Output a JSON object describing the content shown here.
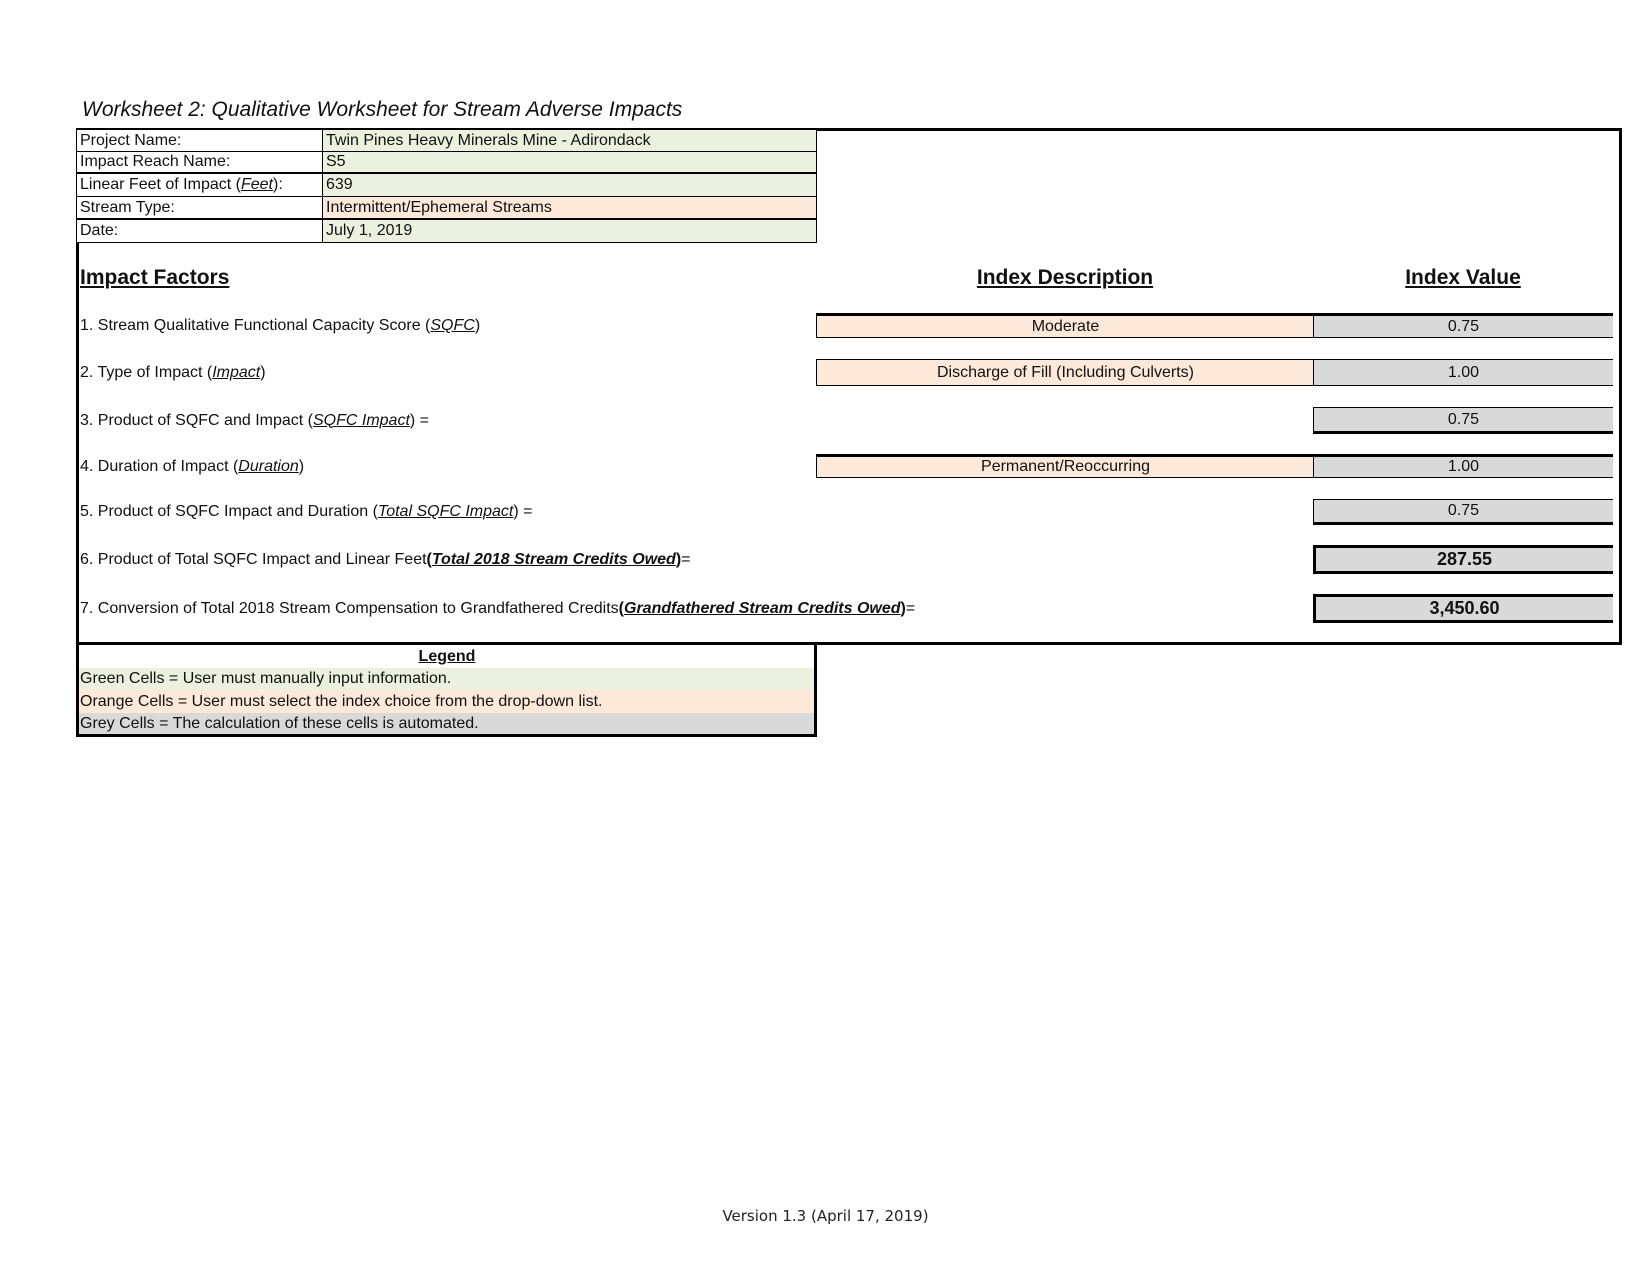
{
  "title": "Worksheet 2:  Qualitative Worksheet for Stream Adverse Impacts",
  "info": {
    "project_name": {
      "label": "Project Name:",
      "value": "Twin Pines Heavy Minerals Mine - Adirondack"
    },
    "impact_reach_name": {
      "label": "Impact Reach Name:",
      "value": "S5"
    },
    "linear_feet": {
      "label_pre": "Linear Feet of Impact (",
      "label_var": "Feet",
      "label_post": "):",
      "value": "639"
    },
    "stream_type": {
      "label": "Stream Type:",
      "value": "Intermittent/Ephemeral Streams"
    },
    "date": {
      "label": "Date:",
      "value": "July 1, 2019"
    }
  },
  "headers": {
    "impact_factors": "Impact Factors",
    "index_description": "Index Description",
    "index_value": "Index Value"
  },
  "factors": [
    {
      "pre": "1. Stream Qualitative Functional Capacity Score (",
      "var": "SQFC",
      "post": ")",
      "description": "Moderate",
      "value": "0.75"
    },
    {
      "pre": "2. Type of Impact (",
      "var": "Impact",
      "post": ")",
      "description": "Discharge of Fill (Including Culverts)",
      "value": "1.00"
    },
    {
      "pre": "3. Product of SQFC and Impact (",
      "var": "SQFC Impact",
      "post": ") =",
      "description": "",
      "value": "0.75"
    },
    {
      "pre": "4. Duration of Impact (",
      "var": "Duration",
      "post": ")",
      "description": "Permanent/Reoccurring",
      "value": "1.00"
    },
    {
      "pre": "5. Product of SQFC Impact and Duration (",
      "var": "Total SQFC Impact",
      "post": ") =",
      "description": "",
      "value": "0.75"
    },
    {
      "pre": "6. Product of Total SQFC Impact and Linear Feet ",
      "paren_open": "(",
      "var": "Total 2018 Stream Credits Owed",
      "paren_close": ")",
      "post": " =",
      "description": "",
      "value": "287.55"
    },
    {
      "pre": "7. Conversion of Total 2018 Stream Compensation to Grandfathered Credits ",
      "paren_open": "(",
      "var": "Grandfathered Stream Credits Owed",
      "paren_close": ")",
      "post": " =",
      "description": "",
      "value": "3,450.60"
    }
  ],
  "legend": {
    "title": "Legend",
    "green": "Green Cells = User must manually input information.",
    "orange": "Orange Cells = User must select the index choice from the drop-down list.",
    "grey": "Grey Cells = The calculation of these cells is automated."
  },
  "colors": {
    "green": "#ebf1de",
    "orange": "#fde9d9",
    "grey": "#d9d9d9"
  },
  "footer": "Version 1.3 (April 17, 2019)"
}
